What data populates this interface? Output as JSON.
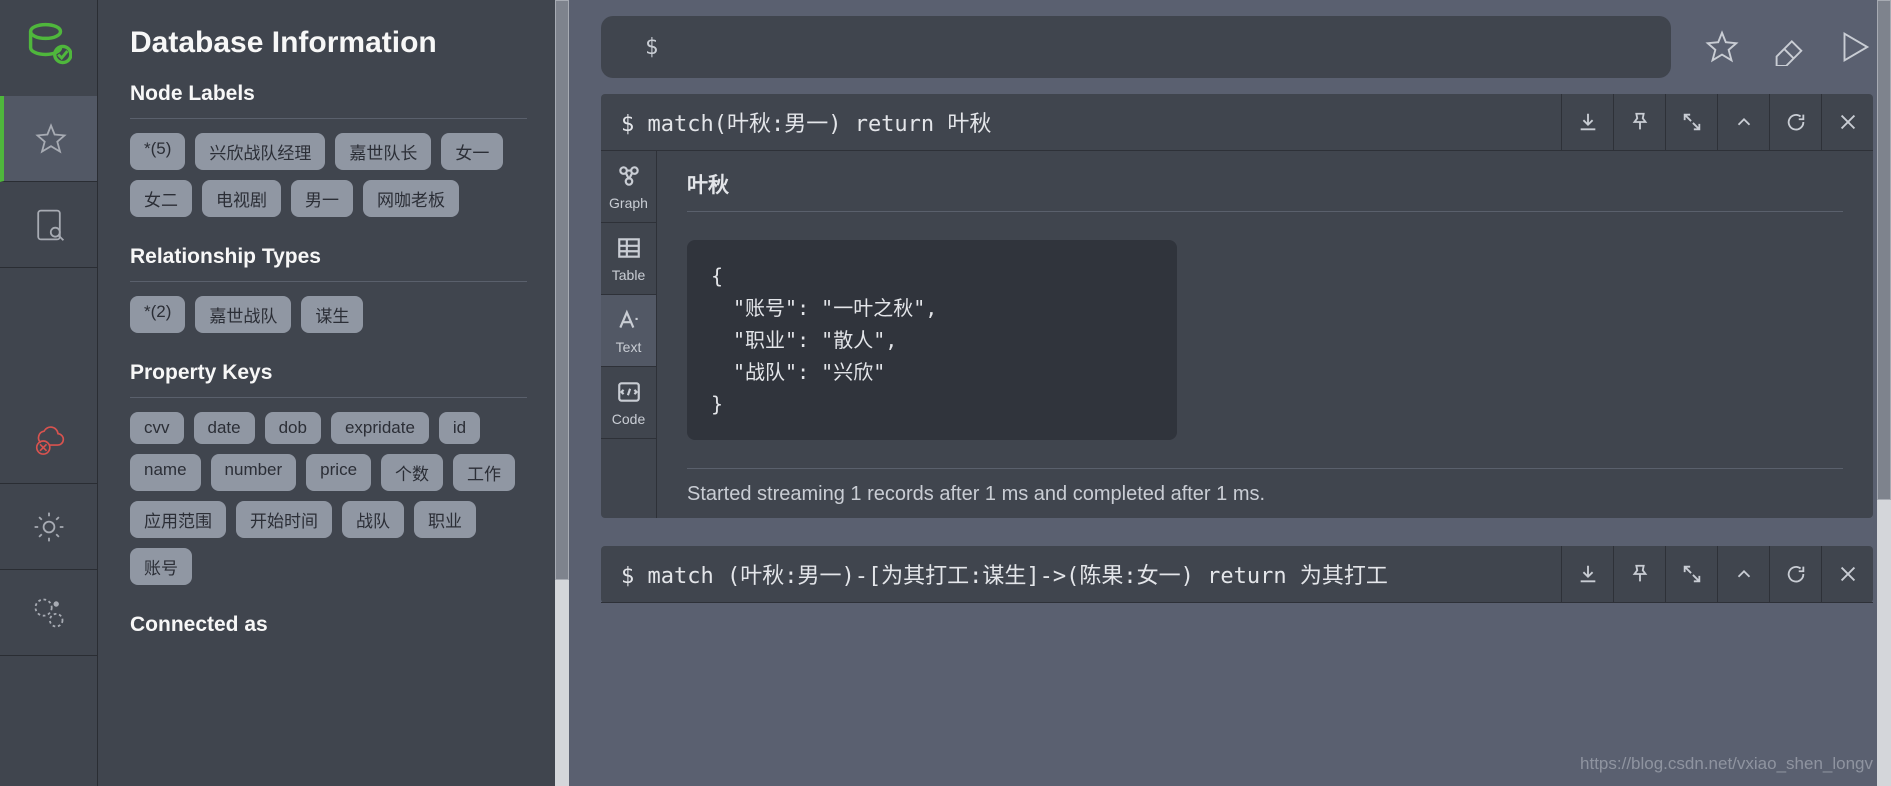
{
  "sidebar": {
    "title": "Database Information",
    "sections": {
      "nodeLabels": {
        "heading": "Node Labels",
        "chips": [
          "*(5)",
          "兴欣战队经理",
          "嘉世队长",
          "女一",
          "女二",
          "电视剧",
          "男一",
          "网咖老板"
        ]
      },
      "relTypes": {
        "heading": "Relationship Types",
        "chips": [
          "*(2)",
          "嘉世战队",
          "谋生"
        ]
      },
      "propKeys": {
        "heading": "Property Keys",
        "chips": [
          "cvv",
          "date",
          "dob",
          "expridate",
          "id",
          "name",
          "number",
          "price",
          "个数",
          "工作",
          "应用范围",
          "开始时间",
          "战队",
          "职业",
          "账号"
        ]
      },
      "connectedAs": {
        "heading": "Connected as"
      }
    }
  },
  "editor": {
    "prompt": "$"
  },
  "frames": [
    {
      "query": "$  match(叶秋:男一) return 叶秋",
      "activeView": "Text",
      "viewTabs": [
        "Graph",
        "Table",
        "Text",
        "Code"
      ],
      "columnHeader": "叶秋",
      "json": {
        "open": "{",
        "rows": [
          "\"账号\": \"一叶之秋\",",
          "\"职业\": \"散人\",",
          "\"战队\": \"兴欣\""
        ],
        "close": "}"
      },
      "status": "Started streaming 1 records after 1 ms and completed after 1 ms."
    },
    {
      "query": "$  match (叶秋:男一)-[为其打工:谋生]->(陈果:女一) return 为其打工"
    }
  ],
  "watermark": "https://blog.csdn.net/vxiao_shen_longv"
}
